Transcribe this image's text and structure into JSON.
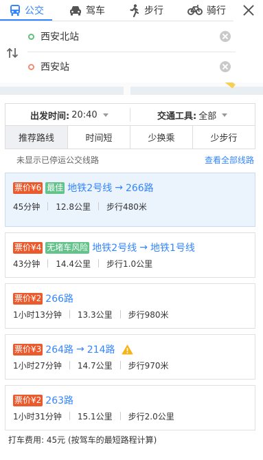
{
  "modes": [
    {
      "label": "公交",
      "icon": "bus-icon",
      "active": true
    },
    {
      "label": "驾车",
      "icon": "car-icon",
      "active": false
    },
    {
      "label": "步行",
      "icon": "walk-icon",
      "active": false
    },
    {
      "label": "骑行",
      "icon": "bike-icon",
      "active": false
    }
  ],
  "origin": "西安北站",
  "destination": "西安站",
  "filter": {
    "depart_label": "出发时间:",
    "depart_value": "20:40",
    "tool_label": "交通工具:",
    "tool_value": "全部",
    "tabs": [
      "推荐路线",
      "时间短",
      "少换乘",
      "少步行"
    ]
  },
  "notice": "未显示已停运公交线路",
  "view_all_link": "查看全部线路",
  "routes": [
    {
      "price": "票价¥6",
      "badge": "最佳",
      "segments": [
        "地铁2号线",
        "266路"
      ],
      "duration": "45分钟",
      "distance": "12.8公里",
      "walk": "步行480米",
      "warning": false
    },
    {
      "price": "票价¥4",
      "badge": "无堵车风险",
      "segments": [
        "地铁2号线",
        "地铁1号线"
      ],
      "duration": "43分钟",
      "distance": "14.4公里",
      "walk": "步行1.0公里",
      "warning": false
    },
    {
      "price": "票价¥2",
      "badge": "",
      "segments": [
        "266路"
      ],
      "duration": "1小时13分钟",
      "distance": "13.3公里",
      "walk": "步行980米",
      "warning": false
    },
    {
      "price": "票价¥3",
      "badge": "",
      "segments": [
        "264路",
        "214路"
      ],
      "duration": "1小时27分钟",
      "distance": "14.7公里",
      "walk": "步行970米",
      "warning": true
    },
    {
      "price": "票价¥2",
      "badge": "",
      "segments": [
        "263路"
      ],
      "duration": "1小时31分钟",
      "distance": "15.1公里",
      "walk": "步行2.0公里",
      "warning": false
    }
  ],
  "route_arrow": "→",
  "taxi_fare": "打车费用: 45元 (按驾车的最短路程计算)",
  "colors": {
    "accent": "#3385ff",
    "price_tag": "#ea5a2d",
    "green_tag": "#64c28b",
    "selected_bg": "#ebf3fd",
    "origin_dot": "#5ec07a",
    "destination_dot": "#f08c72"
  }
}
